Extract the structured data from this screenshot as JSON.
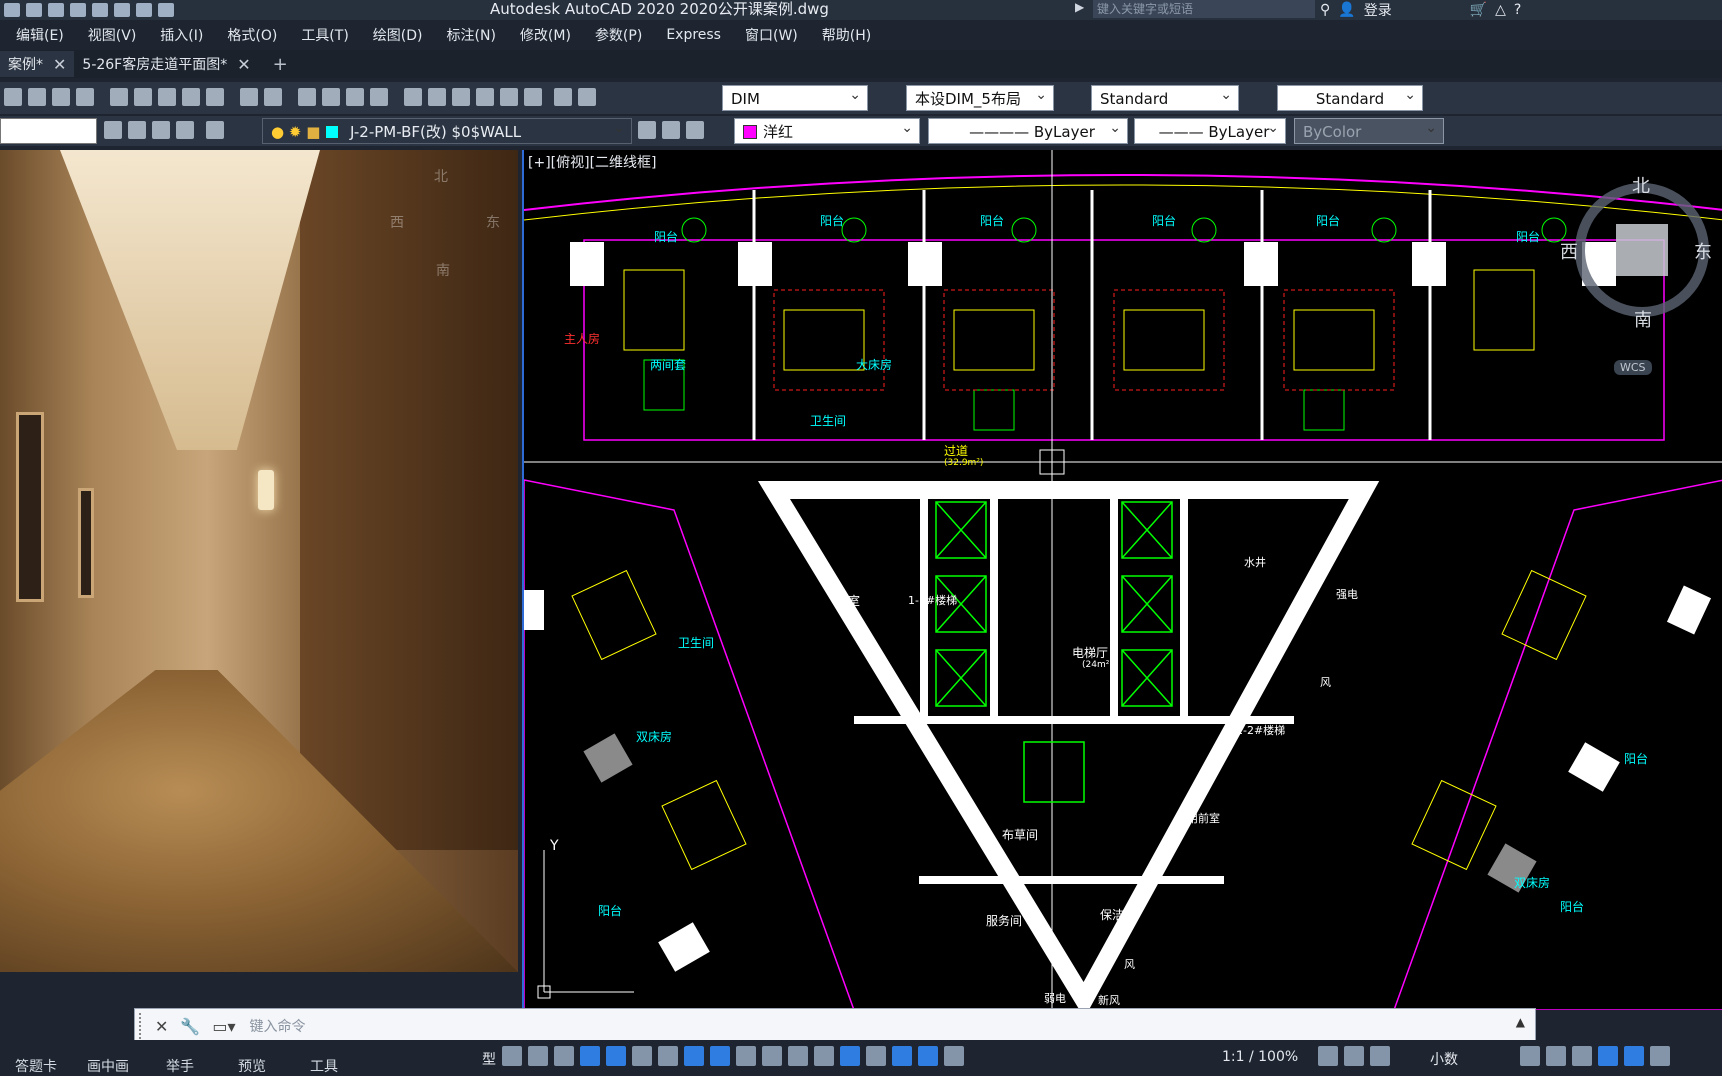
{
  "app": {
    "title": "Autodesk AutoCAD 2020    2020公开课案例.dwg",
    "search_placeholder": "键入关键字或短语",
    "signin": "登录"
  },
  "menu": [
    "编辑(E)",
    "视图(V)",
    "插入(I)",
    "格式(O)",
    "工具(T)",
    "绘图(D)",
    "标注(N)",
    "修改(M)",
    "参数(P)",
    "Express",
    "窗口(W)",
    "帮助(H)"
  ],
  "tabs": [
    {
      "label": "案例*",
      "active": true
    },
    {
      "label": "5-26F客房走道平面图*",
      "active": false
    }
  ],
  "toolbar": {
    "dim_style": "DIM",
    "dim_style2": "本设DIM_5布局",
    "text_style": "Standard",
    "table_style": "Standard",
    "layer": "J-2-PM-BF(改)  $0$WALL",
    "color": "洋红",
    "linetype": "ByLayer",
    "lineweight": "ByLayer",
    "plotstyle": "ByColor"
  },
  "colors": {
    "layer_swatch": "#00ffff",
    "color_swatch": "#ff00ff",
    "accent": "#2f7de0"
  },
  "photo_overlay": {
    "north": "北",
    "west": "西",
    "east": "东",
    "south": "南"
  },
  "viewport": {
    "label": "[+][俯视][二维线框]",
    "compass": {
      "north": "北",
      "west": "西",
      "east": "东",
      "south": "南",
      "wcs": "WCS"
    },
    "rooms": [
      "阳台",
      "阳台",
      "阳台",
      "阳台",
      "阳台",
      "阳台",
      "主人房",
      "两间套",
      "大床房",
      "卫生间",
      "过道",
      "前室",
      "1-1#楼梯",
      "电梯厅",
      "水井",
      "强电",
      "1-2#楼梯",
      "卫生间",
      "双床房",
      "布草间",
      "合用前室",
      "服务间",
      "保洁间",
      "双床房",
      "阳台",
      "阳台",
      "阳台",
      "弱电",
      "新风",
      "风",
      "风"
    ],
    "area_labels": [
      "(32.9m²)",
      "(24m²)"
    ]
  },
  "command": {
    "placeholder": "键入命令"
  },
  "bottom_tabs": [
    "答题卡",
    "画中画",
    "举手",
    "预览",
    "工具"
  ],
  "status": {
    "model_label": "型",
    "scale": "1:1 / 100%",
    "units": "小数"
  }
}
